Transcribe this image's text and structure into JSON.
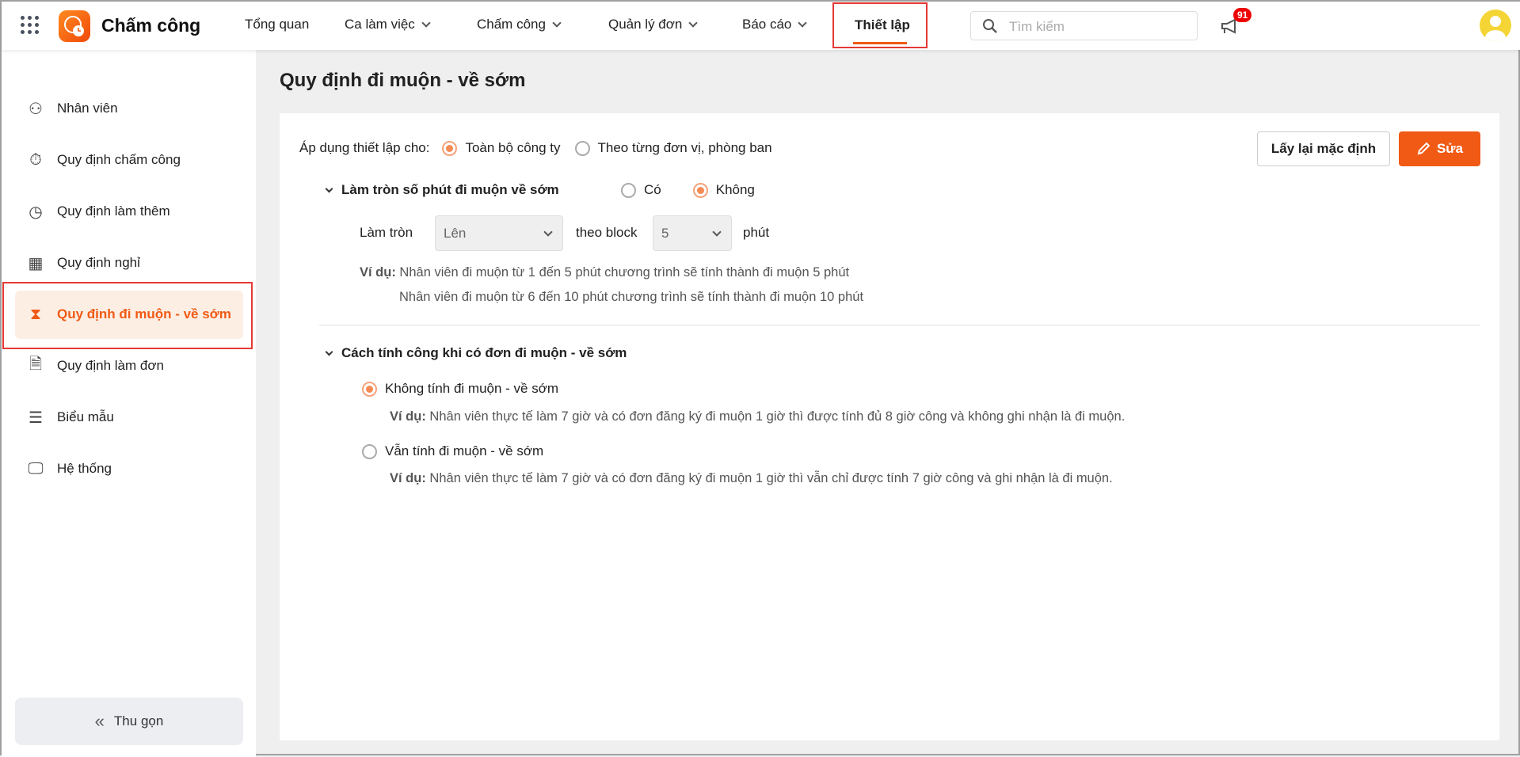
{
  "header": {
    "app_name": "Chấm công",
    "nav": [
      {
        "label": "Tổng quan",
        "dropdown": false
      },
      {
        "label": "Ca làm việc",
        "dropdown": true
      },
      {
        "label": "Chấm công",
        "dropdown": true
      },
      {
        "label": "Quản lý đơn",
        "dropdown": true
      },
      {
        "label": "Báo cáo",
        "dropdown": true
      }
    ],
    "active_nav": "Thiết lập",
    "search_placeholder": "Tìm kiếm",
    "notification_count": "91"
  },
  "sidebar": {
    "items": [
      {
        "label": "Nhân viên",
        "icon": "people-icon"
      },
      {
        "label": "Quy định chấm công",
        "icon": "stopwatch-icon"
      },
      {
        "label": "Quy định làm thêm",
        "icon": "overtime-icon"
      },
      {
        "label": "Quy định nghỉ",
        "icon": "calendar-icon"
      },
      {
        "label": "Quy định đi muộn - về sớm",
        "icon": "hourglass-icon",
        "active": true
      },
      {
        "label": "Quy định làm đơn",
        "icon": "document-clock-icon"
      },
      {
        "label": "Biểu mẫu",
        "icon": "form-icon"
      },
      {
        "label": "Hệ thống",
        "icon": "monitor-icon"
      }
    ],
    "collapse_label": "Thu gọn"
  },
  "main": {
    "title": "Quy định đi muộn - về sớm",
    "apply_label": "Áp dụng thiết lập cho:",
    "apply_options": [
      "Toàn bộ công ty",
      "Theo từng đơn vị, phòng ban"
    ],
    "apply_selected": 0,
    "reset_button": "Lấy lại mặc định",
    "edit_button": "Sửa",
    "section1": {
      "title": "Làm tròn số phút đi muộn về sớm",
      "options": [
        "Có",
        "Không"
      ],
      "selected": 1,
      "round_label": "Làm tròn",
      "round_value": "Lên",
      "block_label": "theo block",
      "block_value": "5",
      "unit": "phút",
      "example_label": "Ví dụ:",
      "example_lines": [
        "Nhân viên đi muộn từ 1 đến 5 phút chương trình sẽ tính thành đi muộn 5 phút",
        "Nhân viên đi muộn từ 6 đến 10 phút chương trình sẽ tính thành đi muộn 10 phút"
      ]
    },
    "section2": {
      "title": "Cách tính công khi có đơn đi muộn - về sớm",
      "selected": 0,
      "options": [
        {
          "label": "Không tính đi muộn - về sớm",
          "example": "Nhân viên thực tế làm 7 giờ và có đơn đăng ký đi muộn 1 giờ thì được tính đủ 8 giờ công và không ghi nhận là đi muộn."
        },
        {
          "label": "Vẫn tính đi muộn - về sớm",
          "example": "Nhân viên thực tế làm 7 giờ và có đơn đăng ký đi muộn 1 giờ thì vẫn chỉ được tính 7 giờ công và ghi nhận là đi muộn."
        }
      ]
    }
  },
  "colors": {
    "accent": "#f05a14",
    "active_bg": "#fdeee4",
    "highlight_outline": "#e53935"
  }
}
